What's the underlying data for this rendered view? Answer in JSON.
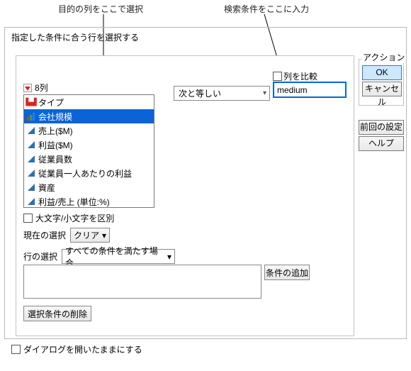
{
  "callouts": {
    "select_column": "目的の列をここで選択",
    "enter_search": "検索条件をここに入力"
  },
  "title": "指定した条件に合う行を選択する",
  "column_picker": {
    "header": "8列",
    "items": [
      {
        "label": "タイプ",
        "icon": "chart",
        "selected": false
      },
      {
        "label": "会社規模",
        "icon": "bars",
        "selected": true
      },
      {
        "label": "売上($M)",
        "icon": "tri",
        "selected": false
      },
      {
        "label": "利益($M)",
        "icon": "tri",
        "selected": false
      },
      {
        "label": "従業員数",
        "icon": "tri",
        "selected": false
      },
      {
        "label": "従業員一人あたりの利益",
        "icon": "tri",
        "selected": false
      },
      {
        "label": "資産",
        "icon": "tri",
        "selected": false
      },
      {
        "label": "利益/売上 (単位:%)",
        "icon": "tri",
        "selected": false
      }
    ]
  },
  "operator": {
    "label": "次と等しい"
  },
  "compare_column": {
    "label": "列を比較",
    "checked": false
  },
  "value": "medium",
  "case_sensitive": {
    "label": "大文字/小文字を区別",
    "checked": false
  },
  "current_selection": {
    "label": "現在の選択",
    "button": "クリア"
  },
  "row_selection": {
    "label": "行の選択",
    "option": "すべての条件を満たす場合"
  },
  "add_condition": "条件の追加",
  "delete_condition": "選択条件の削除",
  "keep_dialog": {
    "label": "ダイアログを開いたままにする",
    "checked": false
  },
  "actions": {
    "group": "アクション",
    "ok": "OK",
    "cancel": "キャンセル",
    "recall": "前回の設定",
    "help": "ヘルプ"
  }
}
